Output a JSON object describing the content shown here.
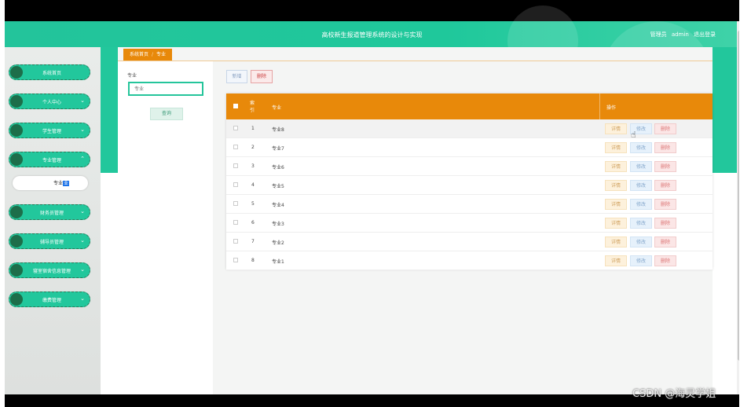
{
  "header": {
    "title": "高校新生报道管理系统的设计与实现",
    "role_label": "管理员",
    "username": "admin",
    "logout_label": "退出登录"
  },
  "sidebar": {
    "items": [
      {
        "label": "系统首页",
        "has_chevron": false
      },
      {
        "label": "个人中心",
        "has_chevron": true
      },
      {
        "label": "学生管理",
        "has_chevron": true
      },
      {
        "label": "专业管理",
        "has_chevron": true,
        "expanded": true
      },
      {
        "label": "财务员管理",
        "has_chevron": true
      },
      {
        "label": "辅导员管理",
        "has_chevron": true
      },
      {
        "label": "寝室宿舍信息管理",
        "has_chevron": true
      },
      {
        "label": "缴费管理",
        "has_chevron": true
      }
    ],
    "sub_item": {
      "label_plain": "专业",
      "label_selected": "业"
    }
  },
  "breadcrumb": {
    "home": "系统首页",
    "separator": "/",
    "current": "专业"
  },
  "search": {
    "label": "专业",
    "placeholder": "专业",
    "query_button": "查询"
  },
  "toolbar": {
    "add_label": "新增",
    "delete_label": "删除"
  },
  "table": {
    "columns": {
      "index": "索引",
      "name": "专业",
      "actions": "操作"
    },
    "rows": [
      {
        "index": "1",
        "name": "专业8"
      },
      {
        "index": "2",
        "name": "专业7"
      },
      {
        "index": "3",
        "name": "专业6"
      },
      {
        "index": "4",
        "name": "专业5"
      },
      {
        "index": "5",
        "name": "专业4"
      },
      {
        "index": "6",
        "name": "专业3"
      },
      {
        "index": "7",
        "name": "专业2"
      },
      {
        "index": "8",
        "name": "专业1"
      }
    ],
    "row_actions": {
      "detail": "详情",
      "edit": "修改",
      "delete": "删除"
    }
  },
  "watermark": "CSDN @海灵学姐",
  "colors": {
    "brand_green": "#22c79c",
    "accent_orange": "#e8890a"
  }
}
